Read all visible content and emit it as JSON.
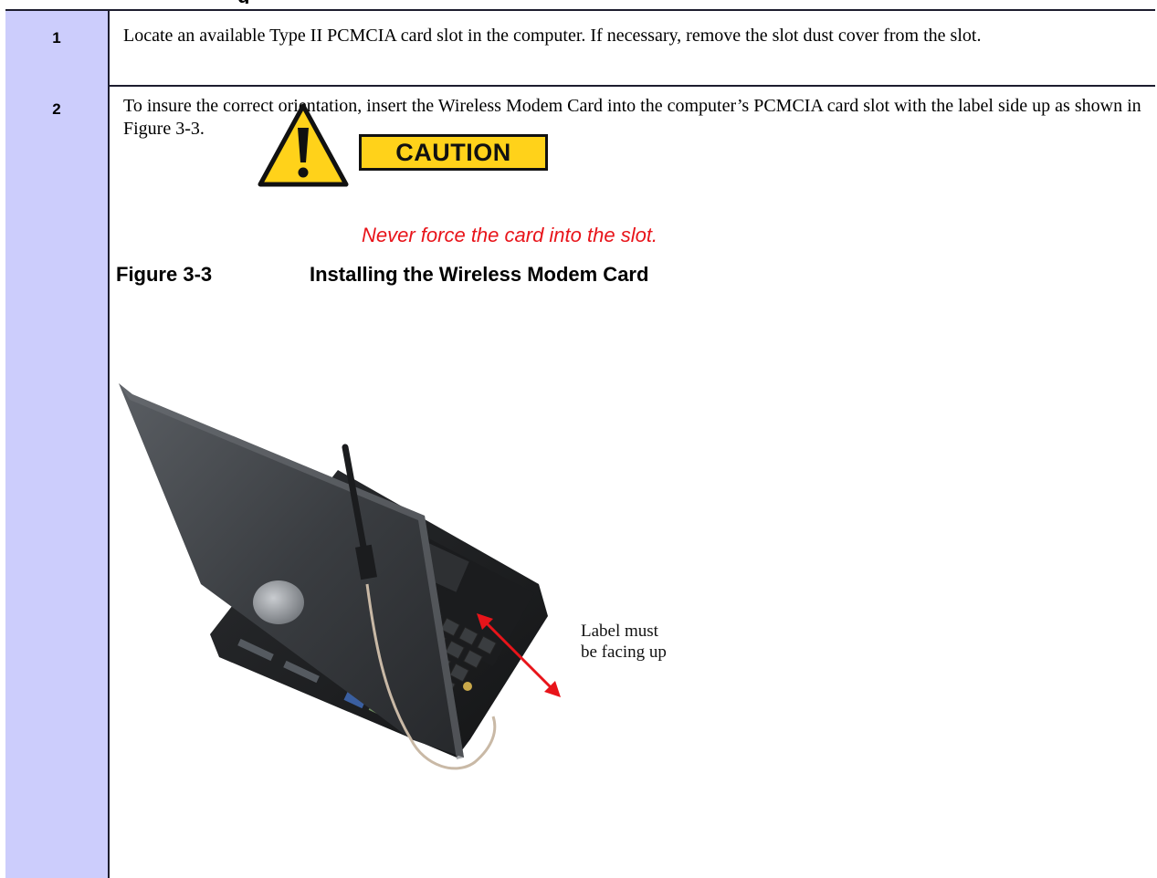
{
  "top_heading_fragment": "g",
  "steps": [
    {
      "number": "1",
      "text": "Locate an available Type II PCMCIA card slot in the computer.  If necessary, remove the slot dust cover from the slot."
    },
    {
      "number": "2",
      "text": "To insure the correct orientation, insert the Wireless Modem Card into the computer’s PCMCIA card slot with the label side up as shown in Figure 3-3."
    }
  ],
  "caution": {
    "label": "CAUTION",
    "note": "Never force the card into the slot.",
    "colors": {
      "label_fill": "#ffd21a",
      "note_text": "#e8141a",
      "triangle": "#ffd21a"
    }
  },
  "figure": {
    "label": "Figure 3-3",
    "title": "Installing the Wireless Modem Card",
    "callout_line1": "Label must",
    "callout_line2": "be facing up",
    "callout_arrow_color": "#e8141a"
  },
  "colors": {
    "step_number_column": "#cccdfc",
    "rule": "#1d1d2e"
  }
}
